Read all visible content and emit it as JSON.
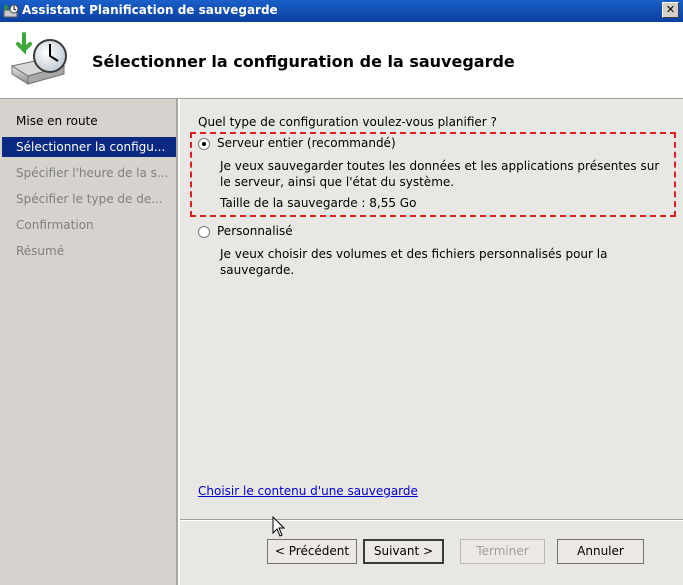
{
  "window": {
    "title": "Assistant Planification de sauvegarde",
    "close_label": "✕"
  },
  "header": {
    "heading": "Sélectionner la configuration de la sauvegarde"
  },
  "sidebar": {
    "items": [
      {
        "label": "Mise en route",
        "state": "done"
      },
      {
        "label": "Sélectionner la configu...",
        "state": "active"
      },
      {
        "label": "Spécifier l'heure de la s...",
        "state": "pending"
      },
      {
        "label": "Spécifier le type de de...",
        "state": "pending"
      },
      {
        "label": "Confirmation",
        "state": "pending"
      },
      {
        "label": "Résumé",
        "state": "pending"
      }
    ]
  },
  "main": {
    "question": "Quel type de configuration voulez-vous planifier ?",
    "options": [
      {
        "label": "Serveur entier (recommandé)",
        "selected": true,
        "description": "Je veux sauvegarder toutes les données et les applications présentes sur le serveur, ainsi que l'état du système.",
        "size_text": "Taille de la sauvegarde : 8,55 Go"
      },
      {
        "label": "Personnalisé",
        "selected": false,
        "description": "Je veux choisir des volumes et des fichiers personnalisés pour la sauvegarde."
      }
    ],
    "link": "Choisir le contenu d'une sauvegarde"
  },
  "buttons": {
    "previous": "< Précédent",
    "next": "Suivant >",
    "finish": "Terminer",
    "cancel": "Annuler"
  },
  "colors": {
    "titlebar": "#0a3f9e",
    "selection": "#0a2a82",
    "highlight_border": "#e02020",
    "link": "#0000cc"
  }
}
